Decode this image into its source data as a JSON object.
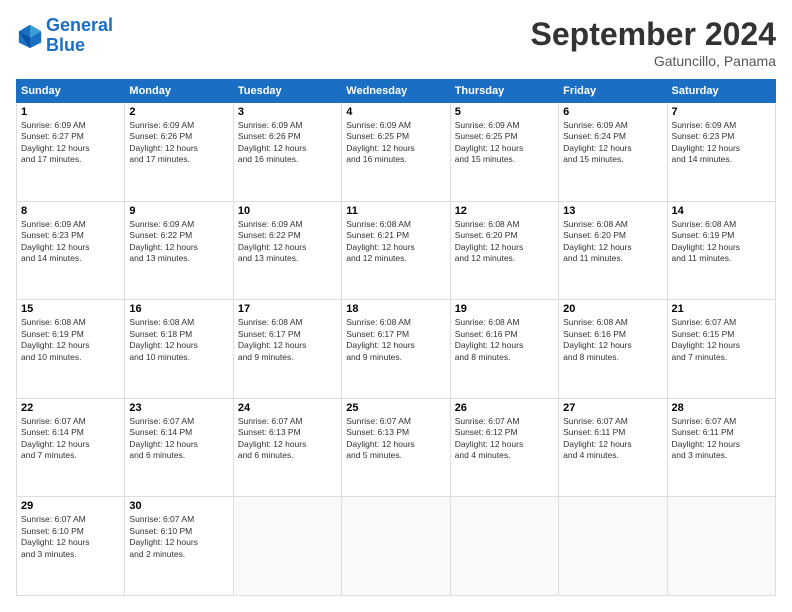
{
  "header": {
    "logo_line1": "General",
    "logo_line2": "Blue",
    "month_title": "September 2024",
    "location": "Gatuncillo, Panama"
  },
  "weekdays": [
    "Sunday",
    "Monday",
    "Tuesday",
    "Wednesday",
    "Thursday",
    "Friday",
    "Saturday"
  ],
  "days": [
    {
      "num": "",
      "info": ""
    },
    {
      "num": "",
      "info": ""
    },
    {
      "num": "",
      "info": ""
    },
    {
      "num": "",
      "info": ""
    },
    {
      "num": "",
      "info": ""
    },
    {
      "num": "",
      "info": ""
    },
    {
      "num": "",
      "info": ""
    },
    {
      "num": "1",
      "info": "Sunrise: 6:09 AM\nSunset: 6:27 PM\nDaylight: 12 hours\nand 17 minutes."
    },
    {
      "num": "2",
      "info": "Sunrise: 6:09 AM\nSunset: 6:26 PM\nDaylight: 12 hours\nand 17 minutes."
    },
    {
      "num": "3",
      "info": "Sunrise: 6:09 AM\nSunset: 6:26 PM\nDaylight: 12 hours\nand 16 minutes."
    },
    {
      "num": "4",
      "info": "Sunrise: 6:09 AM\nSunset: 6:25 PM\nDaylight: 12 hours\nand 16 minutes."
    },
    {
      "num": "5",
      "info": "Sunrise: 6:09 AM\nSunset: 6:25 PM\nDaylight: 12 hours\nand 15 minutes."
    },
    {
      "num": "6",
      "info": "Sunrise: 6:09 AM\nSunset: 6:24 PM\nDaylight: 12 hours\nand 15 minutes."
    },
    {
      "num": "7",
      "info": "Sunrise: 6:09 AM\nSunset: 6:23 PM\nDaylight: 12 hours\nand 14 minutes."
    },
    {
      "num": "8",
      "info": "Sunrise: 6:09 AM\nSunset: 6:23 PM\nDaylight: 12 hours\nand 14 minutes."
    },
    {
      "num": "9",
      "info": "Sunrise: 6:09 AM\nSunset: 6:22 PM\nDaylight: 12 hours\nand 13 minutes."
    },
    {
      "num": "10",
      "info": "Sunrise: 6:09 AM\nSunset: 6:22 PM\nDaylight: 12 hours\nand 13 minutes."
    },
    {
      "num": "11",
      "info": "Sunrise: 6:08 AM\nSunset: 6:21 PM\nDaylight: 12 hours\nand 12 minutes."
    },
    {
      "num": "12",
      "info": "Sunrise: 6:08 AM\nSunset: 6:20 PM\nDaylight: 12 hours\nand 12 minutes."
    },
    {
      "num": "13",
      "info": "Sunrise: 6:08 AM\nSunset: 6:20 PM\nDaylight: 12 hours\nand 11 minutes."
    },
    {
      "num": "14",
      "info": "Sunrise: 6:08 AM\nSunset: 6:19 PM\nDaylight: 12 hours\nand 11 minutes."
    },
    {
      "num": "15",
      "info": "Sunrise: 6:08 AM\nSunset: 6:19 PM\nDaylight: 12 hours\nand 10 minutes."
    },
    {
      "num": "16",
      "info": "Sunrise: 6:08 AM\nSunset: 6:18 PM\nDaylight: 12 hours\nand 10 minutes."
    },
    {
      "num": "17",
      "info": "Sunrise: 6:08 AM\nSunset: 6:17 PM\nDaylight: 12 hours\nand 9 minutes."
    },
    {
      "num": "18",
      "info": "Sunrise: 6:08 AM\nSunset: 6:17 PM\nDaylight: 12 hours\nand 9 minutes."
    },
    {
      "num": "19",
      "info": "Sunrise: 6:08 AM\nSunset: 6:16 PM\nDaylight: 12 hours\nand 8 minutes."
    },
    {
      "num": "20",
      "info": "Sunrise: 6:08 AM\nSunset: 6:16 PM\nDaylight: 12 hours\nand 8 minutes."
    },
    {
      "num": "21",
      "info": "Sunrise: 6:07 AM\nSunset: 6:15 PM\nDaylight: 12 hours\nand 7 minutes."
    },
    {
      "num": "22",
      "info": "Sunrise: 6:07 AM\nSunset: 6:14 PM\nDaylight: 12 hours\nand 7 minutes."
    },
    {
      "num": "23",
      "info": "Sunrise: 6:07 AM\nSunset: 6:14 PM\nDaylight: 12 hours\nand 6 minutes."
    },
    {
      "num": "24",
      "info": "Sunrise: 6:07 AM\nSunset: 6:13 PM\nDaylight: 12 hours\nand 6 minutes."
    },
    {
      "num": "25",
      "info": "Sunrise: 6:07 AM\nSunset: 6:13 PM\nDaylight: 12 hours\nand 5 minutes."
    },
    {
      "num": "26",
      "info": "Sunrise: 6:07 AM\nSunset: 6:12 PM\nDaylight: 12 hours\nand 4 minutes."
    },
    {
      "num": "27",
      "info": "Sunrise: 6:07 AM\nSunset: 6:11 PM\nDaylight: 12 hours\nand 4 minutes."
    },
    {
      "num": "28",
      "info": "Sunrise: 6:07 AM\nSunset: 6:11 PM\nDaylight: 12 hours\nand 3 minutes."
    },
    {
      "num": "29",
      "info": "Sunrise: 6:07 AM\nSunset: 6:10 PM\nDaylight: 12 hours\nand 3 minutes."
    },
    {
      "num": "30",
      "info": "Sunrise: 6:07 AM\nSunset: 6:10 PM\nDaylight: 12 hours\nand 2 minutes."
    },
    {
      "num": "",
      "info": ""
    },
    {
      "num": "",
      "info": ""
    },
    {
      "num": "",
      "info": ""
    },
    {
      "num": "",
      "info": ""
    },
    {
      "num": "",
      "info": ""
    }
  ]
}
